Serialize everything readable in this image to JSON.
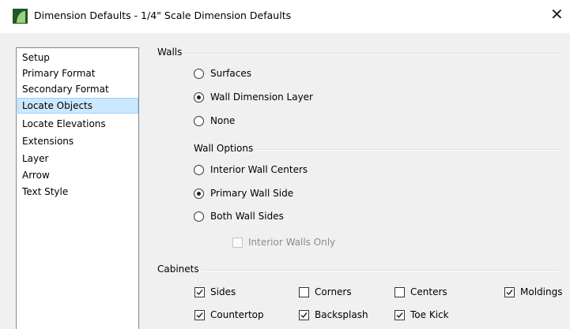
{
  "window": {
    "title": "Dimension Defaults - 1/4\" Scale Dimension Defaults",
    "close_glyph": "✕"
  },
  "sidebar": {
    "items": [
      {
        "label": "Setup",
        "selected": false
      },
      {
        "label": "Primary Format",
        "selected": false
      },
      {
        "label": "Secondary Format",
        "selected": false
      },
      {
        "label": "Locate Objects",
        "selected": true
      },
      {
        "label": "Locate Elevations",
        "selected": false
      },
      {
        "label": "Extensions",
        "selected": false
      },
      {
        "label": "Layer",
        "selected": false
      },
      {
        "label": "Arrow",
        "selected": false
      },
      {
        "label": "Text Style",
        "selected": false
      }
    ]
  },
  "walls": {
    "title": "Walls",
    "options": [
      {
        "label": "Surfaces",
        "checked": false
      },
      {
        "label": "Wall Dimension Layer",
        "checked": true
      },
      {
        "label": "None",
        "checked": false
      }
    ]
  },
  "wall_options": {
    "title": "Wall Options",
    "options": [
      {
        "label": "Interior Wall Centers",
        "checked": false
      },
      {
        "label": "Primary Wall Side",
        "checked": true
      },
      {
        "label": "Both Wall Sides",
        "checked": false
      }
    ],
    "interior_walls_only": {
      "label": "Interior Walls Only",
      "checked": false,
      "disabled": true
    }
  },
  "cabinets": {
    "title": "Cabinets",
    "checkboxes": [
      {
        "label": "Sides",
        "checked": true
      },
      {
        "label": "Corners",
        "checked": false
      },
      {
        "label": "Centers",
        "checked": false
      },
      {
        "label": "Moldings",
        "checked": true
      },
      {
        "label": "Countertop",
        "checked": true
      },
      {
        "label": "Backsplash",
        "checked": true
      },
      {
        "label": "Toe Kick",
        "checked": true
      }
    ]
  },
  "colors": {
    "selection_bg": "#cce8ff",
    "selection_border": "#99d1ff",
    "dialog_bg": "#f0f0f0",
    "app_icon": "#1d5a2b"
  },
  "icons": {
    "app": "chief-architect-logo-icon",
    "close": "close-icon"
  }
}
